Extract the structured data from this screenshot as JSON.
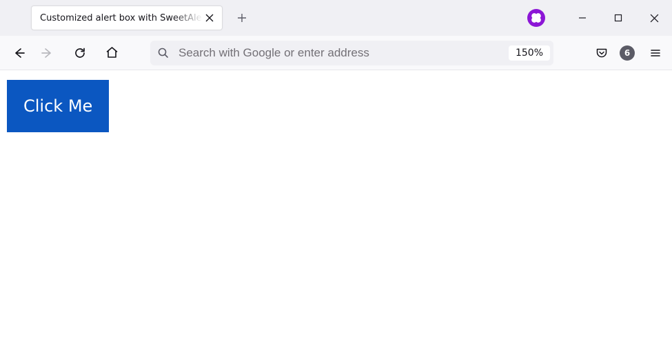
{
  "tab": {
    "title": "Customized alert box with SweetAlert"
  },
  "urlbar": {
    "placeholder": "Search with Google or enter address",
    "zoom": "150%"
  },
  "toolbar": {
    "notification_count": "6"
  },
  "page": {
    "button_label": "Click Me"
  }
}
